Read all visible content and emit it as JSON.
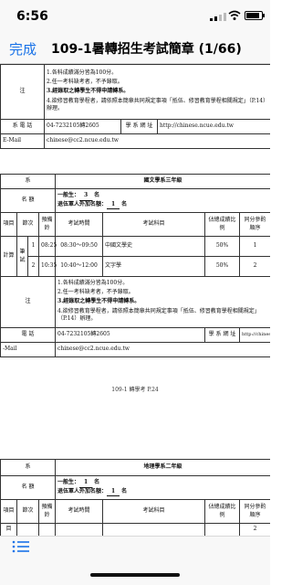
{
  "status_bar": {
    "time": "6:56"
  },
  "nav": {
    "done_label": "完成",
    "title": "109-1暑轉招生考試簡章 (1/66)"
  },
  "top_section": {
    "notes_label": "注",
    "notes": [
      "1.各科成績滿分皆為100分。",
      "2.任一考科缺考者，不予錄取。",
      "3.經錄取之轉學生不得申請轉系。",
      "4.欲修習教育學程者，請依照本簡章共同規定事項「抵伍、修習教育學程相關規定」（P.14）辦理。"
    ],
    "phone_label": "系 電 話",
    "phone": "04-7232105轉2605",
    "web_label": "學 系 網 址",
    "web": "http://chinese.ncue.edu.tw",
    "email_label": "E-Mail",
    "email": "chinese@cc2.ncue.edu.tw"
  },
  "middle_section": {
    "dept_label": "系",
    "dept_name": "國文學系三年級",
    "quota_label": "名 額",
    "quota_general": "一般生：",
    "quota_general_n": "3",
    "quota_unit": "名",
    "quota_transfer": "退伍軍人外加名額：",
    "quota_transfer_n": "1",
    "headers": {
      "item": "項目",
      "order": "節次",
      "prep": "預備鈴",
      "time": "考試時間",
      "subject": "考試科目",
      "weight": "佔總成績比例",
      "tie": "同分參酌順序"
    },
    "exam_label": "筆試",
    "exam_label2": "計算",
    "rows": [
      {
        "no": "1",
        "prep": "08:25",
        "time": "08:30～09:50",
        "subject": "中國文學史",
        "weight": "50%",
        "tie": "1"
      },
      {
        "no": "2",
        "prep": "10:35",
        "time": "10:40～12:00",
        "subject": "文字學",
        "weight": "50%",
        "tie": "2"
      }
    ],
    "notes_label": "注",
    "notes": [
      "1.各科成績滿分皆為100分。",
      "2.任一考科缺考者，不予錄取。",
      "3.經錄取之轉學生不得申請轉系。",
      "4.欲修習教育學程者，請依照本簡章共同規定事項「抵伍、修習教育學程相關規定」（P.14）辦理。"
    ],
    "phone_label": "電 話",
    "phone": "04-7232105轉2605",
    "web_label": "學 系 網 址",
    "web": "http://chinese.ncue.edu.tw",
    "email_label": "-Mail",
    "email": "chinese@cc2.ncue.edu.tw"
  },
  "page_number": "109-1 轉學考 P.24",
  "bottom_section": {
    "dept_label": "系",
    "dept_name": "地理學系二年級",
    "quota_label": "名 額",
    "quota_general": "一般生：",
    "quota_general_n": "1",
    "quota_unit": "名",
    "quota_transfer": "退伍軍人外加名額：",
    "quota_transfer_n": "1",
    "headers": {
      "item": "項目",
      "order": "節次",
      "prep": "預備鈴",
      "time": "考試時間",
      "subject": "考試科目",
      "weight": "佔總成績比例",
      "tie": "同分參酌順序"
    },
    "exam_label": "目",
    "partial_row": {
      "weight": "",
      "tie": "2"
    }
  },
  "toolbar": {
    "list_icon": "list-icon"
  }
}
